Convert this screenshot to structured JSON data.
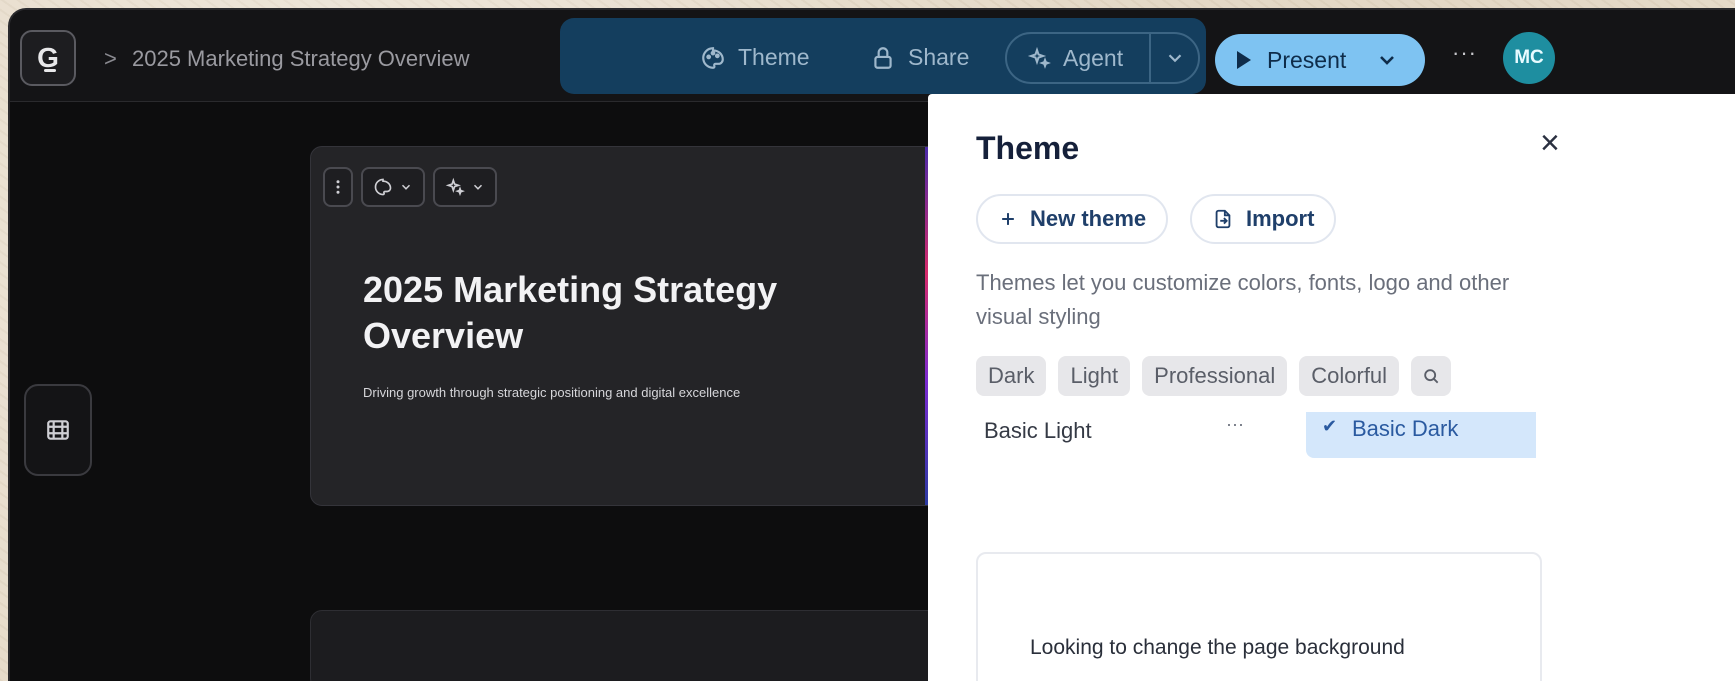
{
  "header": {
    "doc_title": "2025 Marketing Strategy Overview",
    "breadcrumb_separator": ">",
    "theme_label": "Theme",
    "share_label": "Share",
    "agent_label": "Agent",
    "present_label": "Present",
    "more_label": "···",
    "avatar_initials": "MC",
    "logo_letter": "G"
  },
  "slide": {
    "title": "2025 Marketing Strategy Overview",
    "subtitle": "Driving growth through strategic positioning and digital excellence"
  },
  "theme_panel": {
    "title": "Theme",
    "close_label": "×",
    "new_theme_label": "New theme",
    "import_label": "Import",
    "description": "Themes let you customize colors, fonts, logo and other visual styling",
    "filters": [
      "Dark",
      "Light",
      "Professional",
      "Colorful"
    ],
    "themes": [
      {
        "name": "Basic Light",
        "selected": false
      },
      {
        "name": "Basic Dark",
        "selected": true
      }
    ],
    "info_text": "Looking to change the page background"
  },
  "colors": {
    "accent": "#7ec3f2",
    "toolbar_highlight": "#143e5e",
    "avatar": "#1e8ea0",
    "selected_theme_bg": "#d4e7fb"
  }
}
